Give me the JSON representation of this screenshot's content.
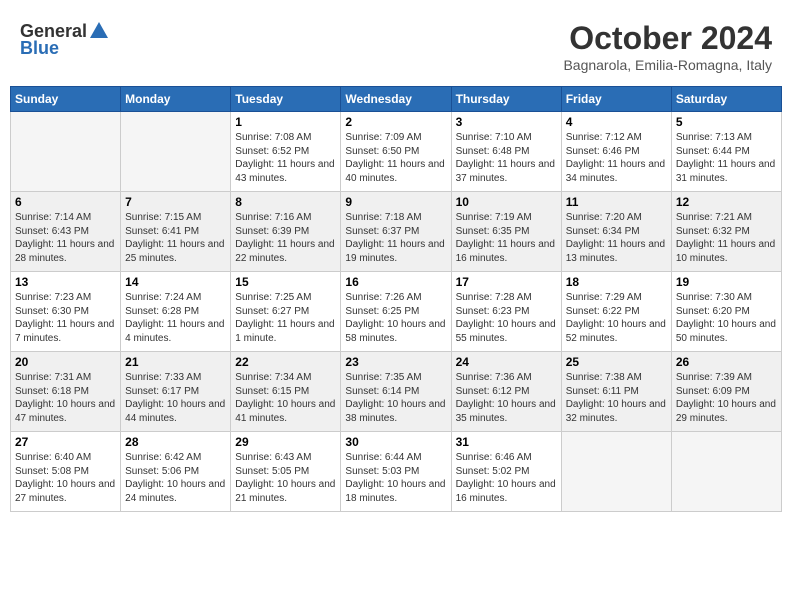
{
  "header": {
    "logo_general": "General",
    "logo_blue": "Blue",
    "month_title": "October 2024",
    "location": "Bagnarola, Emilia-Romagna, Italy"
  },
  "weekdays": [
    "Sunday",
    "Monday",
    "Tuesday",
    "Wednesday",
    "Thursday",
    "Friday",
    "Saturday"
  ],
  "weeks": [
    [
      {
        "day": "",
        "sunrise": "",
        "sunset": "",
        "daylight": ""
      },
      {
        "day": "",
        "sunrise": "",
        "sunset": "",
        "daylight": ""
      },
      {
        "day": "1",
        "sunrise": "Sunrise: 7:08 AM",
        "sunset": "Sunset: 6:52 PM",
        "daylight": "Daylight: 11 hours and 43 minutes."
      },
      {
        "day": "2",
        "sunrise": "Sunrise: 7:09 AM",
        "sunset": "Sunset: 6:50 PM",
        "daylight": "Daylight: 11 hours and 40 minutes."
      },
      {
        "day": "3",
        "sunrise": "Sunrise: 7:10 AM",
        "sunset": "Sunset: 6:48 PM",
        "daylight": "Daylight: 11 hours and 37 minutes."
      },
      {
        "day": "4",
        "sunrise": "Sunrise: 7:12 AM",
        "sunset": "Sunset: 6:46 PM",
        "daylight": "Daylight: 11 hours and 34 minutes."
      },
      {
        "day": "5",
        "sunrise": "Sunrise: 7:13 AM",
        "sunset": "Sunset: 6:44 PM",
        "daylight": "Daylight: 11 hours and 31 minutes."
      }
    ],
    [
      {
        "day": "6",
        "sunrise": "Sunrise: 7:14 AM",
        "sunset": "Sunset: 6:43 PM",
        "daylight": "Daylight: 11 hours and 28 minutes."
      },
      {
        "day": "7",
        "sunrise": "Sunrise: 7:15 AM",
        "sunset": "Sunset: 6:41 PM",
        "daylight": "Daylight: 11 hours and 25 minutes."
      },
      {
        "day": "8",
        "sunrise": "Sunrise: 7:16 AM",
        "sunset": "Sunset: 6:39 PM",
        "daylight": "Daylight: 11 hours and 22 minutes."
      },
      {
        "day": "9",
        "sunrise": "Sunrise: 7:18 AM",
        "sunset": "Sunset: 6:37 PM",
        "daylight": "Daylight: 11 hours and 19 minutes."
      },
      {
        "day": "10",
        "sunrise": "Sunrise: 7:19 AM",
        "sunset": "Sunset: 6:35 PM",
        "daylight": "Daylight: 11 hours and 16 minutes."
      },
      {
        "day": "11",
        "sunrise": "Sunrise: 7:20 AM",
        "sunset": "Sunset: 6:34 PM",
        "daylight": "Daylight: 11 hours and 13 minutes."
      },
      {
        "day": "12",
        "sunrise": "Sunrise: 7:21 AM",
        "sunset": "Sunset: 6:32 PM",
        "daylight": "Daylight: 11 hours and 10 minutes."
      }
    ],
    [
      {
        "day": "13",
        "sunrise": "Sunrise: 7:23 AM",
        "sunset": "Sunset: 6:30 PM",
        "daylight": "Daylight: 11 hours and 7 minutes."
      },
      {
        "day": "14",
        "sunrise": "Sunrise: 7:24 AM",
        "sunset": "Sunset: 6:28 PM",
        "daylight": "Daylight: 11 hours and 4 minutes."
      },
      {
        "day": "15",
        "sunrise": "Sunrise: 7:25 AM",
        "sunset": "Sunset: 6:27 PM",
        "daylight": "Daylight: 11 hours and 1 minute."
      },
      {
        "day": "16",
        "sunrise": "Sunrise: 7:26 AM",
        "sunset": "Sunset: 6:25 PM",
        "daylight": "Daylight: 10 hours and 58 minutes."
      },
      {
        "day": "17",
        "sunrise": "Sunrise: 7:28 AM",
        "sunset": "Sunset: 6:23 PM",
        "daylight": "Daylight: 10 hours and 55 minutes."
      },
      {
        "day": "18",
        "sunrise": "Sunrise: 7:29 AM",
        "sunset": "Sunset: 6:22 PM",
        "daylight": "Daylight: 10 hours and 52 minutes."
      },
      {
        "day": "19",
        "sunrise": "Sunrise: 7:30 AM",
        "sunset": "Sunset: 6:20 PM",
        "daylight": "Daylight: 10 hours and 50 minutes."
      }
    ],
    [
      {
        "day": "20",
        "sunrise": "Sunrise: 7:31 AM",
        "sunset": "Sunset: 6:18 PM",
        "daylight": "Daylight: 10 hours and 47 minutes."
      },
      {
        "day": "21",
        "sunrise": "Sunrise: 7:33 AM",
        "sunset": "Sunset: 6:17 PM",
        "daylight": "Daylight: 10 hours and 44 minutes."
      },
      {
        "day": "22",
        "sunrise": "Sunrise: 7:34 AM",
        "sunset": "Sunset: 6:15 PM",
        "daylight": "Daylight: 10 hours and 41 minutes."
      },
      {
        "day": "23",
        "sunrise": "Sunrise: 7:35 AM",
        "sunset": "Sunset: 6:14 PM",
        "daylight": "Daylight: 10 hours and 38 minutes."
      },
      {
        "day": "24",
        "sunrise": "Sunrise: 7:36 AM",
        "sunset": "Sunset: 6:12 PM",
        "daylight": "Daylight: 10 hours and 35 minutes."
      },
      {
        "day": "25",
        "sunrise": "Sunrise: 7:38 AM",
        "sunset": "Sunset: 6:11 PM",
        "daylight": "Daylight: 10 hours and 32 minutes."
      },
      {
        "day": "26",
        "sunrise": "Sunrise: 7:39 AM",
        "sunset": "Sunset: 6:09 PM",
        "daylight": "Daylight: 10 hours and 29 minutes."
      }
    ],
    [
      {
        "day": "27",
        "sunrise": "Sunrise: 6:40 AM",
        "sunset": "Sunset: 5:08 PM",
        "daylight": "Daylight: 10 hours and 27 minutes."
      },
      {
        "day": "28",
        "sunrise": "Sunrise: 6:42 AM",
        "sunset": "Sunset: 5:06 PM",
        "daylight": "Daylight: 10 hours and 24 minutes."
      },
      {
        "day": "29",
        "sunrise": "Sunrise: 6:43 AM",
        "sunset": "Sunset: 5:05 PM",
        "daylight": "Daylight: 10 hours and 21 minutes."
      },
      {
        "day": "30",
        "sunrise": "Sunrise: 6:44 AM",
        "sunset": "Sunset: 5:03 PM",
        "daylight": "Daylight: 10 hours and 18 minutes."
      },
      {
        "day": "31",
        "sunrise": "Sunrise: 6:46 AM",
        "sunset": "Sunset: 5:02 PM",
        "daylight": "Daylight: 10 hours and 16 minutes."
      },
      {
        "day": "",
        "sunrise": "",
        "sunset": "",
        "daylight": ""
      },
      {
        "day": "",
        "sunrise": "",
        "sunset": "",
        "daylight": ""
      }
    ]
  ]
}
